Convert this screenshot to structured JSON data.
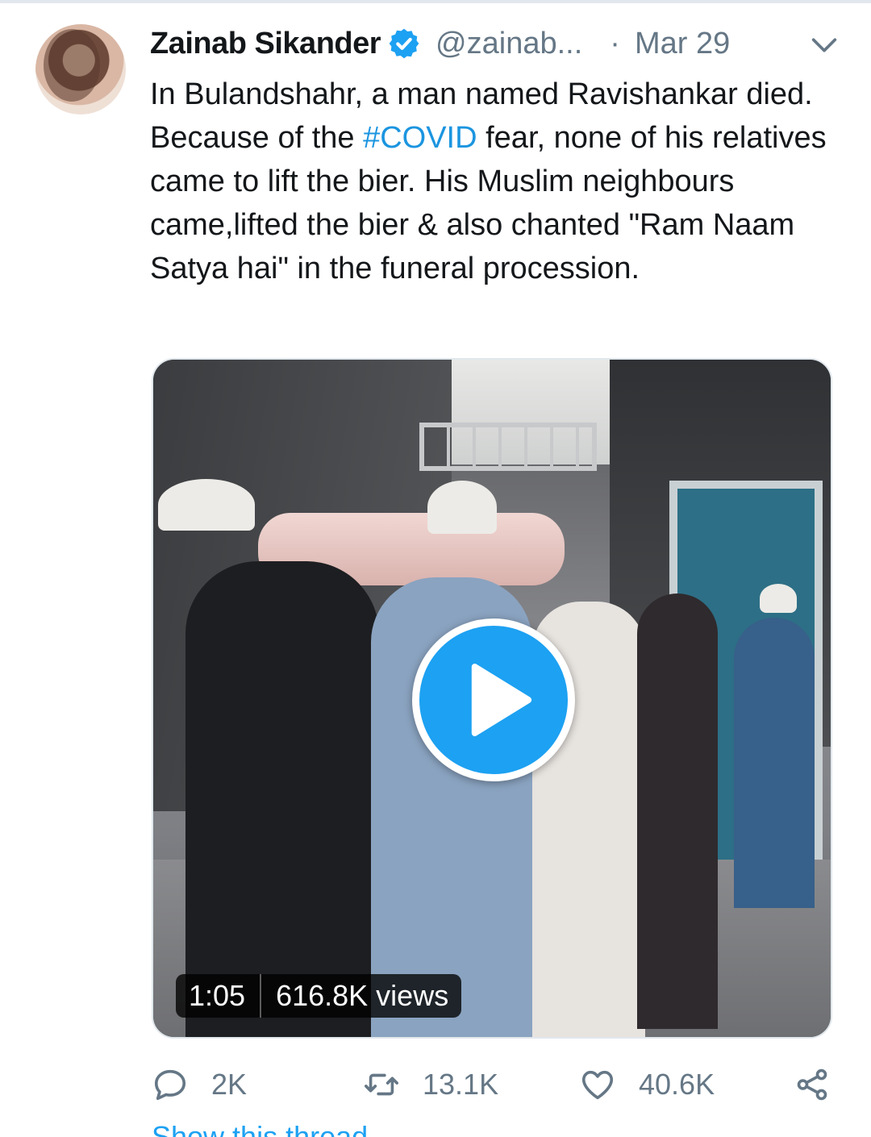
{
  "tweet": {
    "author_name": "Zainab Sikander",
    "handle": "@zainab...",
    "separator": "·",
    "date": "Mar 29",
    "text_before": "In Bulandshahr, a man named Ravishankar died. Because of the ",
    "hashtag": "#COVID",
    "text_after": " fear, none of his relatives came to lift the bier. His Muslim neighbours came,lifted the bier & also chanted \"Ram Naam Satya hai\" in the funeral procession."
  },
  "media": {
    "duration": "1:05",
    "views": "616.8K views"
  },
  "actions": {
    "replies": "2K",
    "retweets": "13.1K",
    "likes": "40.6K"
  },
  "footer": {
    "thread_link": "Show this thread"
  },
  "colors": {
    "accent": "#1da1f2",
    "hashtag": "#1b95e0",
    "secondary_text": "#657786",
    "primary_text": "#14171a"
  },
  "icons": [
    "verified-badge-icon",
    "chevron-down-icon",
    "play-icon",
    "reply-icon",
    "retweet-icon",
    "like-icon",
    "share-icon"
  ]
}
